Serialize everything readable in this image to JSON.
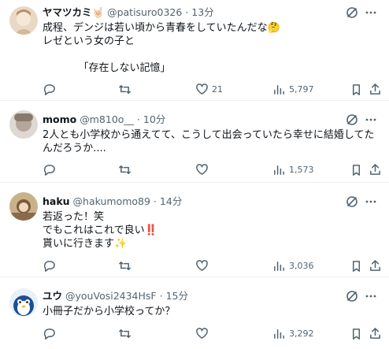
{
  "replies": [
    {
      "name": "ヤマツカミ🤘🏻",
      "handle": "@patisuro0326",
      "time": "· 13分",
      "text": "成程、デンジは若い頃から青春をしていたんだな🤔\nレゼという女の子と\n\n　　　　「存在しない記憶」",
      "replies": "",
      "retweets": "",
      "likes": "21",
      "views": "5,797"
    },
    {
      "name": "momo",
      "handle": "@m810o__",
      "time": "· 10分",
      "text": "2人とも小学校から通えてて、こうして出会っていたら幸せに結婚してたんだろうか....",
      "replies": "",
      "retweets": "",
      "likes": "",
      "views": "1,573"
    },
    {
      "name": "haku",
      "handle": "@hakumomo89",
      "time": "· 14分",
      "text": "若返った！笑\nでもこれはこれで良い‼️\n貰いに行きます✨",
      "replies": "",
      "retweets": "",
      "likes": "",
      "views": "3,036"
    },
    {
      "name": "ユウ",
      "handle": "@youVosi2434HsF",
      "time": "· 15分",
      "text": "小冊子だから小学校ってか？",
      "replies": "",
      "retweets": "",
      "likes": "",
      "views": "3,292"
    }
  ],
  "icons": {
    "reply": "reply-icon",
    "retweet": "retweet-icon",
    "like": "heart-icon",
    "views": "views-icon",
    "bookmark": "bookmark-icon",
    "share": "share-icon",
    "grok": "grok-icon",
    "more": "more-icon"
  }
}
